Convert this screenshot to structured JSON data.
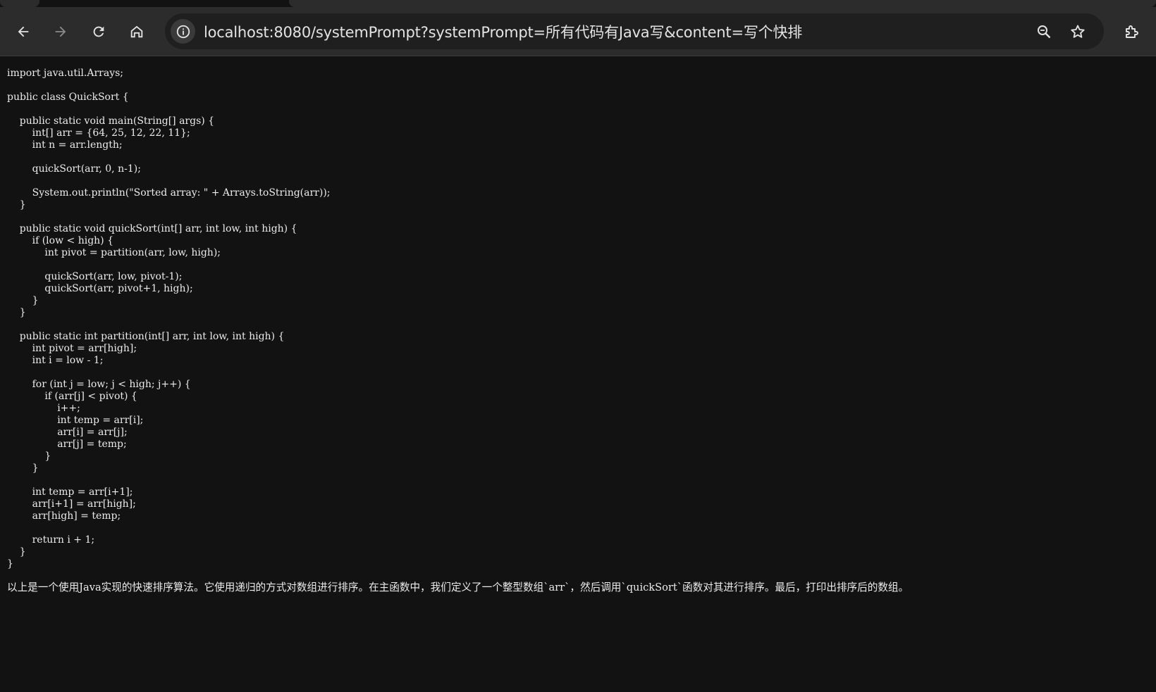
{
  "browser": {
    "url": "localhost:8080/systemPrompt?systemPrompt=所有代码有Java写&content=写个快排",
    "icons": {
      "back": "arrow-left-icon",
      "forward": "arrow-right-icon",
      "reload": "reload-icon",
      "home": "home-icon",
      "site_info": "info-icon",
      "zoom": "zoom-icon",
      "bookmark": "star-icon",
      "extensions": "puzzle-icon"
    },
    "colors": {
      "toolbar": "#2c2c2c",
      "omnibox": "#1f1f1f",
      "page_background": "#121212",
      "text": "#ececec"
    }
  },
  "page": {
    "code": "import java.util.Arrays;\n\npublic class QuickSort {\n\n    public static void main(String[] args) {\n        int[] arr = {64, 25, 12, 22, 11};\n        int n = arr.length;\n\n        quickSort(arr, 0, n-1);\n\n        System.out.println(\"Sorted array: \" + Arrays.toString(arr));\n    }\n\n    public static void quickSort(int[] arr, int low, int high) {\n        if (low < high) {\n            int pivot = partition(arr, low, high);\n\n            quickSort(arr, low, pivot-1);\n            quickSort(arr, pivot+1, high);\n        }\n    }\n\n    public static int partition(int[] arr, int low, int high) {\n        int pivot = arr[high];\n        int i = low - 1;\n\n        for (int j = low; j < high; j++) {\n            if (arr[j] < pivot) {\n                i++;\n                int temp = arr[i];\n                arr[i] = arr[j];\n                arr[j] = temp;\n            }\n        }\n\n        int temp = arr[i+1];\n        arr[i+1] = arr[high];\n        arr[high] = temp;\n\n        return i + 1;\n    }\n}",
    "description": "以上是一个使用Java实现的快速排序算法。它使用递归的方式对数组进行排序。在主函数中，我们定义了一个整型数组`arr`，然后调用`quickSort`函数对其进行排序。最后，打印出排序后的数组。"
  }
}
